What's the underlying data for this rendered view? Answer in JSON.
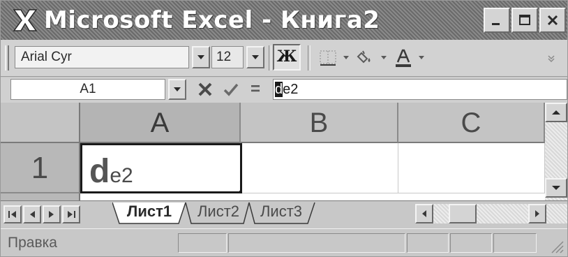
{
  "window": {
    "title": "Microsoft Excel - Книга2",
    "app_icon": "excel-x-icon"
  },
  "toolbar": {
    "font_name": "Arial Cyr",
    "font_size": "12",
    "bold_label": "Ж",
    "icons": [
      "border-icon",
      "fill-color-icon",
      "font-color-icon"
    ]
  },
  "formula_bar": {
    "name_box": "A1",
    "equals": "=",
    "content_caret": "d",
    "content_rest": "e2"
  },
  "grid": {
    "columns": [
      "A",
      "B",
      "C"
    ],
    "rows": [
      "1"
    ],
    "cell_a1_big": "d",
    "cell_a1_rest": "e2"
  },
  "sheets": {
    "tabs": [
      "Лист1",
      "Лист2",
      "Лист3"
    ],
    "active": "Лист1"
  },
  "status": {
    "text": "Правка"
  }
}
